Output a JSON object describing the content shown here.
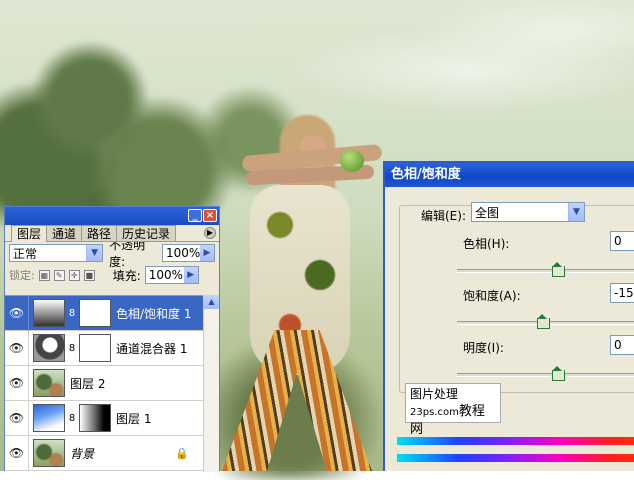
{
  "layers_panel": {
    "tabs": [
      {
        "label": "图层",
        "active": true
      },
      {
        "label": "通道",
        "active": false
      },
      {
        "label": "路径",
        "active": false
      },
      {
        "label": "历史记录",
        "active": false
      }
    ],
    "blend_mode": "正常",
    "opacity_label": "不透明度:",
    "opacity_value": "100%",
    "lock_label": "锁定:",
    "fill_label": "填充:",
    "fill_value": "100%",
    "layers": [
      {
        "name": "色相/饱和度 1",
        "selected": true,
        "thumb": "adjustment",
        "has_mask": true
      },
      {
        "name": "通道混合器 1",
        "selected": false,
        "thumb": "mixer",
        "has_mask": true
      },
      {
        "name": "图层 2",
        "selected": false,
        "thumb": "photo",
        "has_mask": false
      },
      {
        "name": "图层 1",
        "selected": false,
        "thumb": "sky",
        "has_mask": true
      },
      {
        "name": "背景",
        "selected": false,
        "thumb": "photo",
        "has_mask": false,
        "locked": true
      }
    ]
  },
  "hue_dialog": {
    "title": "色相/饱和度",
    "edit_label": "编辑(E):",
    "edit_value": "全图",
    "hue_label": "色相(H):",
    "hue_value": "0",
    "saturation_label": "饱和度(A):",
    "saturation_value": "-15",
    "lightness_label": "明度(I):",
    "lightness_value": "0"
  },
  "watermark": {
    "line1": "图片处理",
    "site": "23ps.com",
    "suffix": "教程网"
  },
  "colors": {
    "titlebar": "#1a4cc0",
    "selected_row": "#3a66c4",
    "panel_bg": "#ece9d8"
  }
}
